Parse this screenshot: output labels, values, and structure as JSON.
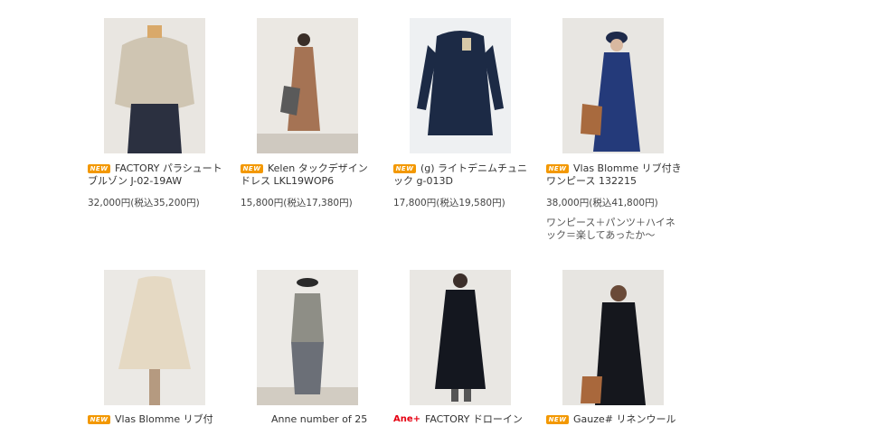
{
  "products": [
    {
      "badge": "NEW",
      "title": "FACTORY パラシュートブルゾン J-02-19AW",
      "price": "32,000円(税込35,200円)",
      "desc": ""
    },
    {
      "badge": "NEW",
      "title": "Kelen タックデザインドレス LKL19WOP6",
      "price": "15,800円(税込17,380円)",
      "desc": ""
    },
    {
      "badge": "NEW",
      "title": "(g) ライトデニムチュニック g-013D",
      "price": "17,800円(税込19,580円)",
      "desc": ""
    },
    {
      "badge": "NEW",
      "title": "Vlas Blomme リブ付きワンピース 132215",
      "price": "38,000円(税込41,800円)",
      "desc": "ワンピース＋パンツ＋ハイネック＝楽してあったか〜"
    },
    {
      "badge": "NEW",
      "title": "Vlas Blomme リブ付",
      "price": "",
      "desc": ""
    },
    {
      "badge": "",
      "title": "Anne number of 25",
      "price": "",
      "desc": ""
    },
    {
      "badge": "Ane+",
      "title": "FACTORY ドローイン",
      "price": "",
      "desc": ""
    },
    {
      "badge": "NEW",
      "title": "Gauze# リネンウール",
      "price": "",
      "desc": ""
    }
  ],
  "colors": {
    "badge": "#f39800",
    "accent_red": "#e60012"
  },
  "icons": [
    "new-badge-icon"
  ]
}
